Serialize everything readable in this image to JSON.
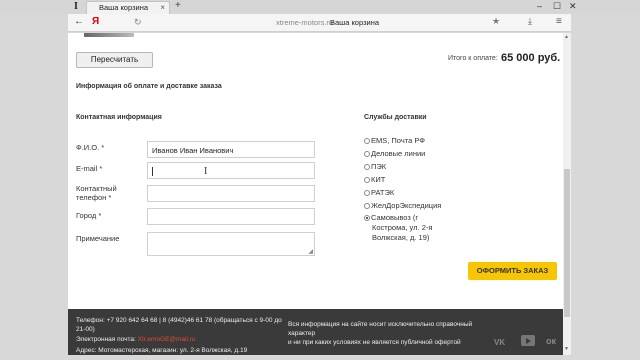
{
  "browser": {
    "logo": "I",
    "tab_title": "Ваша корзина",
    "tab_close": "×",
    "tab_add": "+",
    "window_minimize": "–",
    "window_maximize": "☐",
    "window_close": "✕",
    "back": "←",
    "yandex_logo": "Я",
    "reload": "↻",
    "url_host": "xtreme-motors.ru",
    "url_title": "Ваша корзина",
    "bookmark": "★",
    "download": "⤓",
    "menu": "≡"
  },
  "cart": {
    "recalc_label": "Пересчитать",
    "total_label": "Итого к оплате:",
    "total_value": "65 000 руб."
  },
  "order_section_title": "Информация об оплате и доставке заказа",
  "contact": {
    "title": "Контактная информация",
    "fields": [
      {
        "label": "Ф.И.О. *",
        "value": "Иванов Иван Иванович"
      },
      {
        "label": "E-mail *",
        "value": ""
      },
      {
        "label": "Контактный телефон *",
        "value": ""
      },
      {
        "label": "Город *",
        "value": ""
      },
      {
        "label": "Примечание",
        "value": ""
      }
    ]
  },
  "delivery": {
    "title": "Службы доставки",
    "options": [
      {
        "label": "EMS, Почта РФ",
        "selected": false
      },
      {
        "label": "Деловые линии",
        "selected": false
      },
      {
        "label": "ПЭК",
        "selected": false
      },
      {
        "label": "КИТ",
        "selected": false
      },
      {
        "label": "РАТЭК",
        "selected": false
      },
      {
        "label": "ЖелДорЭкспедиция",
        "selected": false
      },
      {
        "label": "Самовывоз (г",
        "selected": true
      }
    ],
    "pickup_address_line1": "Кострома, ул. 2-я",
    "pickup_address_line2": "Волжская, д. 19)"
  },
  "order_button_label": "ОФОРМИТЬ ЗАКАЗ",
  "footer": {
    "phone_line1": "Телефон: +7 920 642 64 68 | 8 (4942)46 61 78 (обращаться с 9-00 до",
    "phone_line2": "21-00)",
    "email_label": "Электронная почта:",
    "email_value": "Xtr.emoGE@mail.ru",
    "address": "Адрес: Мотомастерская, магазин: ул. 2-я Волжская, д.19",
    "disclaimer_line1": "Вся информация на сайте носит исключительно справочный",
    "disclaimer_line2": "характер",
    "disclaimer_line3": "и ни при каких условиях не является публичной офертой",
    "social_vk": "VK",
    "social_ok": "ок"
  },
  "colors": {
    "order_button": "#f7c600",
    "footer_bg": "#3a3a3a",
    "footer_link": "#e04a3a"
  }
}
